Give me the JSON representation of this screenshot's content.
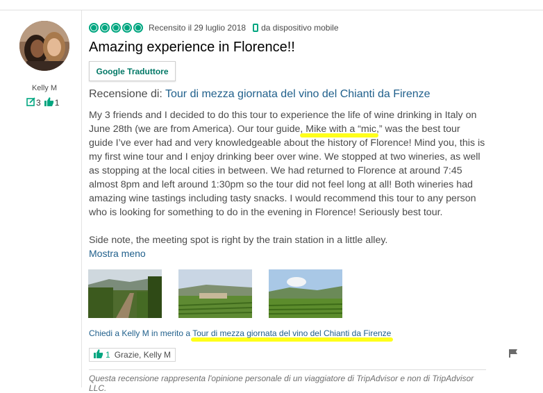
{
  "reviewer": {
    "name": "Kelly M",
    "reviews_count": "3",
    "helpful_votes": "1"
  },
  "review": {
    "rating_bubbles": 5,
    "date_text": "Recensito il 29 luglio 2018",
    "device_text": "da dispositivo mobile",
    "title": "Amazing experience in Florence!!",
    "translate_button": "Google Traduttore",
    "review_of_label": "Recensione di:",
    "review_of_link": "Tour di mezza giornata del vino del Chianti da Firenze",
    "body_p1": "My 3 friends and I decided to do this tour to experience the life of wine drinking in Italy on June 28th (we are from America). Our tour guide, Mike with a “mic,” was the best tour guide I’ve ever had and very knowledgeable about the history of Florence! Mind you, this is my first wine tour and I enjoy drinking beer over wine. We stopped at two wineries, as well as stopping at the local cities in between. We had returned to Florence at around 7:45 almost 8pm and left around 1:30pm so the tour did not feel long at all! Both wineries had amazing wine tastings including tasty snacks. I would recommend this tour to any person who is looking for something to do in the evening in Florence! Seriously best tour.",
    "body_p2": "Side note, the meeting spot is right by the train station in a little alley.",
    "show_less": "Mostra meno",
    "ask_prefix": "Chiedi a Kelly M in merito a",
    "ask_link": "Tour di mezza giornata del vino del Chianti da Firenze",
    "thanks_count": "1",
    "thanks_label": "Grazie, Kelly M",
    "disclaimer": "Questa recensione rappresenta l'opinione personale di un viaggiatore di TripAdvisor e non di TripAdvisor LLC."
  },
  "colors": {
    "accent_green": "#00a680",
    "link_blue": "#1f5f8b",
    "highlight_yellow": "#ffff1a"
  },
  "icons": [
    "review-count-icon",
    "thumbs-up-icon",
    "mobile-device-icon",
    "flag-icon",
    "rating-bubble-icon"
  ]
}
